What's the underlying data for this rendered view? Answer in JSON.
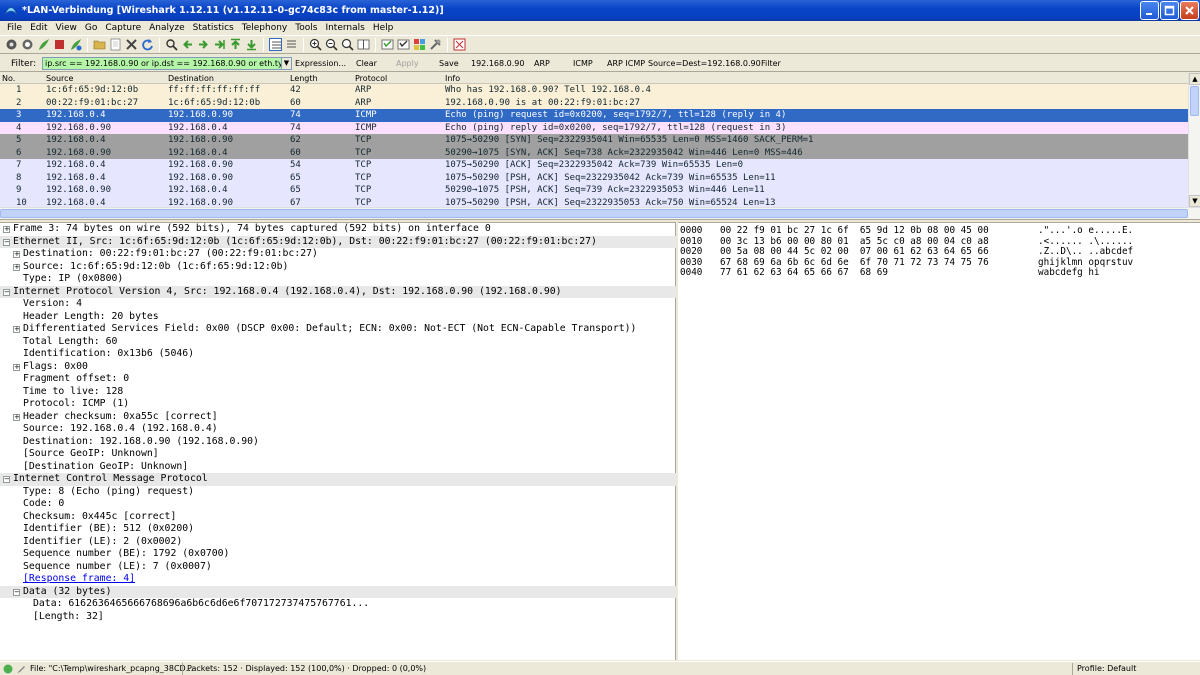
{
  "window": {
    "title": "*LAN-Verbindung  [Wireshark 1.12.11  (v1.12.11-0-gc74c83c from master-1.12)]"
  },
  "menu": [
    "File",
    "Edit",
    "View",
    "Go",
    "Capture",
    "Analyze",
    "Statistics",
    "Telephony",
    "Tools",
    "Internals",
    "Help"
  ],
  "toolbar": {
    "icons": [
      "interfaces-icon",
      "options-icon",
      "start-capture-icon",
      "stop-capture-icon",
      "restart-capture-icon",
      "open-file-icon",
      "save-file-icon",
      "close-file-icon",
      "reload-icon",
      "find-icon",
      "back-icon",
      "forward-icon",
      "goto-packet-icon",
      "first-packet-icon",
      "last-packet-icon",
      "colorize-icon",
      "autoscroll-icon",
      "zoom-in-icon",
      "zoom-out-icon",
      "normal-size-icon",
      "resize-columns-icon",
      "capture-filters-icon",
      "display-filters-icon",
      "coloring-rules-icon",
      "preferences-icon",
      "help-icon"
    ]
  },
  "filter": {
    "label": "Filter:",
    "value": "ip.src == 192.168.0.90 or ip.dst == 192.168.0.90 or eth.type == ",
    "expression_label": "Expression...",
    "clear_label": "Clear",
    "apply_label": "Apply",
    "save_label": "Save",
    "quick_buttons": [
      "192.168.0.90",
      "ARP",
      "ICMP",
      "ARP ICMP",
      "Source=Dest=192.168.0.90",
      "Filter"
    ]
  },
  "packet_list": {
    "columns": [
      "No.",
      "Source",
      "Destination",
      "Length",
      "Protocol",
      "Info"
    ],
    "rows": [
      {
        "no": "1",
        "src": "1c:6f:65:9d:12:0b",
        "dst": "ff:ff:ff:ff:ff:ff",
        "len": "42",
        "proto": "ARP",
        "info": "Who has 192.168.0.90?  Tell 192.168.0.4",
        "bg": "#faf0d7",
        "fg": "#12272e"
      },
      {
        "no": "2",
        "src": "00:22:f9:01:bc:27",
        "dst": "1c:6f:65:9d:12:0b",
        "len": "60",
        "proto": "ARP",
        "info": "192.168.0.90 is at 00:22:f9:01:bc:27",
        "bg": "#faf0d7",
        "fg": "#12272e"
      },
      {
        "no": "3",
        "src": "192.168.0.4",
        "dst": "192.168.0.90",
        "len": "74",
        "proto": "ICMP",
        "info": "Echo (ping) request  id=0x0200, seq=1792/7, ttl=128 (reply in 4)",
        "bg": "#316ac5",
        "fg": "#ffffff"
      },
      {
        "no": "4",
        "src": "192.168.0.90",
        "dst": "192.168.0.4",
        "len": "74",
        "proto": "ICMP",
        "info": "Echo (ping) reply    id=0x0200, seq=1792/7, ttl=128 (request in 3)",
        "bg": "#fce0ff",
        "fg": "#12272e"
      },
      {
        "no": "5",
        "src": "192.168.0.4",
        "dst": "192.168.0.90",
        "len": "62",
        "proto": "TCP",
        "info": "1075→50290 [SYN] Seq=2322935041 Win=65535 Len=0 MSS=1460 SACK_PERM=1",
        "bg": "#a0a0a0",
        "fg": "#12272e"
      },
      {
        "no": "6",
        "src": "192.168.0.90",
        "dst": "192.168.0.4",
        "len": "60",
        "proto": "TCP",
        "info": "50290→1075 [SYN, ACK] Seq=738 Ack=2322935042 Win=446 Len=0 MSS=446",
        "bg": "#a0a0a0",
        "fg": "#12272e"
      },
      {
        "no": "7",
        "src": "192.168.0.4",
        "dst": "192.168.0.90",
        "len": "54",
        "proto": "TCP",
        "info": "1075→50290 [ACK] Seq=2322935042 Ack=739 Win=65535 Len=0",
        "bg": "#e7e6ff",
        "fg": "#12272e"
      },
      {
        "no": "8",
        "src": "192.168.0.4",
        "dst": "192.168.0.90",
        "len": "65",
        "proto": "TCP",
        "info": "1075→50290 [PSH, ACK] Seq=2322935042 Ack=739 Win=65535 Len=11",
        "bg": "#e7e6ff",
        "fg": "#12272e"
      },
      {
        "no": "9",
        "src": "192.168.0.90",
        "dst": "192.168.0.4",
        "len": "65",
        "proto": "TCP",
        "info": "50290→1075 [PSH, ACK] Seq=739 Ack=2322935053 Win=446 Len=11",
        "bg": "#e7e6ff",
        "fg": "#12272e"
      },
      {
        "no": "10",
        "src": "192.168.0.4",
        "dst": "192.168.0.90",
        "len": "67",
        "proto": "TCP",
        "info": "1075→50290 [PSH, ACK] Seq=2322935053 Ack=750 Win=65524 Len=13",
        "bg": "#e7e6ff",
        "fg": "#12272e"
      }
    ]
  },
  "details": [
    {
      "text": "Frame 3: 74 bytes on wire (592 bits), 74 bytes captured (592 bits) on interface 0",
      "level": 0,
      "expander": "+",
      "header": false
    },
    {
      "text": "Ethernet II, Src: 1c:6f:65:9d:12:0b (1c:6f:65:9d:12:0b), Dst: 00:22:f9:01:bc:27 (00:22:f9:01:bc:27)",
      "level": 0,
      "expander": "-",
      "header": true
    },
    {
      "text": "Destination: 00:22:f9:01:bc:27 (00:22:f9:01:bc:27)",
      "level": 1,
      "expander": "+",
      "header": false
    },
    {
      "text": "Source: 1c:6f:65:9d:12:0b (1c:6f:65:9d:12:0b)",
      "level": 1,
      "expander": "+",
      "header": false
    },
    {
      "text": "Type: IP (0x0800)",
      "level": 1,
      "expander": "",
      "header": false
    },
    {
      "text": "Internet Protocol Version 4, Src: 192.168.0.4 (192.168.0.4), Dst: 192.168.0.90 (192.168.0.90)",
      "level": 0,
      "expander": "-",
      "header": true
    },
    {
      "text": "Version: 4",
      "level": 1,
      "expander": "",
      "header": false
    },
    {
      "text": "Header Length: 20 bytes",
      "level": 1,
      "expander": "",
      "header": false
    },
    {
      "text": "Differentiated Services Field: 0x00 (DSCP 0x00: Default; ECN: 0x00: Not-ECT (Not ECN-Capable Transport))",
      "level": 1,
      "expander": "+",
      "header": false
    },
    {
      "text": "Total Length: 60",
      "level": 1,
      "expander": "",
      "header": false
    },
    {
      "text": "Identification: 0x13b6 (5046)",
      "level": 1,
      "expander": "",
      "header": false
    },
    {
      "text": "Flags: 0x00",
      "level": 1,
      "expander": "+",
      "header": false
    },
    {
      "text": "Fragment offset: 0",
      "level": 1,
      "expander": "",
      "header": false
    },
    {
      "text": "Time to live: 128",
      "level": 1,
      "expander": "",
      "header": false
    },
    {
      "text": "Protocol: ICMP (1)",
      "level": 1,
      "expander": "",
      "header": false
    },
    {
      "text": "Header checksum: 0xa55c [correct]",
      "level": 1,
      "expander": "+",
      "header": false
    },
    {
      "text": "Source: 192.168.0.4 (192.168.0.4)",
      "level": 1,
      "expander": "",
      "header": false
    },
    {
      "text": "Destination: 192.168.0.90 (192.168.0.90)",
      "level": 1,
      "expander": "",
      "header": false
    },
    {
      "text": "[Source GeoIP: Unknown]",
      "level": 1,
      "expander": "",
      "header": false
    },
    {
      "text": "[Destination GeoIP: Unknown]",
      "level": 1,
      "expander": "",
      "header": false
    },
    {
      "text": "Internet Control Message Protocol",
      "level": 0,
      "expander": "-",
      "header": true
    },
    {
      "text": "Type: 8 (Echo (ping) request)",
      "level": 1,
      "expander": "",
      "header": false
    },
    {
      "text": "Code: 0",
      "level": 1,
      "expander": "",
      "header": false
    },
    {
      "text": "Checksum: 0x445c [correct]",
      "level": 1,
      "expander": "",
      "header": false
    },
    {
      "text": "Identifier (BE): 512 (0x0200)",
      "level": 1,
      "expander": "",
      "header": false
    },
    {
      "text": "Identifier (LE): 2 (0x0002)",
      "level": 1,
      "expander": "",
      "header": false
    },
    {
      "text": "Sequence number (BE): 1792 (0x0700)",
      "level": 1,
      "expander": "",
      "header": false
    },
    {
      "text": "Sequence number (LE): 7 (0x0007)",
      "level": 1,
      "expander": "",
      "header": false
    },
    {
      "text": "[Response frame: 4]",
      "level": 1,
      "expander": "",
      "header": false,
      "link": true
    },
    {
      "text": "Data (32 bytes)",
      "level": 1,
      "expander": "-",
      "header": true
    },
    {
      "text": "Data: 6162636465666768696a6b6c6d6e6f707172737475767761...",
      "level": 2,
      "expander": "",
      "header": false
    },
    {
      "text": "[Length: 32]",
      "level": 2,
      "expander": "",
      "header": false
    }
  ],
  "hex": [
    {
      "offset": "0000",
      "bytes": "00 22 f9 01 bc 27 1c 6f  65 9d 12 0b 08 00 45 00",
      "ascii": ".\"...'.o e.....E."
    },
    {
      "offset": "0010",
      "bytes": "00 3c 13 b6 00 00 80 01  a5 5c c0 a8 00 04 c0 a8",
      "ascii": ".<...... .\\......"
    },
    {
      "offset": "0020",
      "bytes": "00 5a 08 00 44 5c 02 00  07 00 61 62 63 64 65 66",
      "ascii": ".Z..D\\.. ..abcdef"
    },
    {
      "offset": "0030",
      "bytes": "67 68 69 6a 6b 6c 6d 6e  6f 70 71 72 73 74 75 76",
      "ascii": "ghijklmn opqrstuv"
    },
    {
      "offset": "0040",
      "bytes": "77 61 62 63 64 65 66 67  68 69",
      "ascii": "wabcdefg hi"
    }
  ],
  "status": {
    "file": "File: \"C:\\Temp\\wireshark_pcapng_38CD...",
    "packets": "Packets: 152 · Displayed: 152 (100,0%) · Dropped: 0 (0,0%)",
    "profile": "Profile: Default"
  }
}
